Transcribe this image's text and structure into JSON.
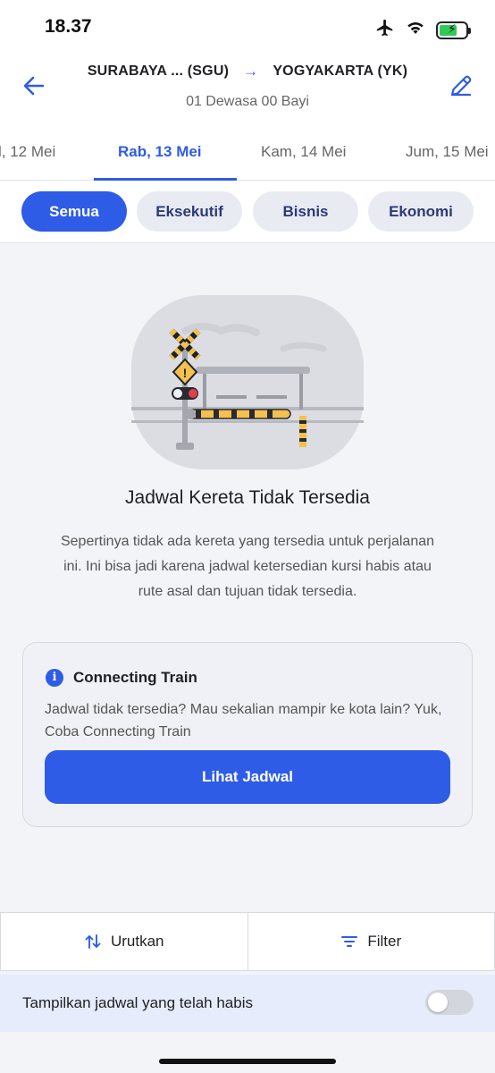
{
  "status_bar": {
    "time": "18.37",
    "icons": [
      "airplane-icon",
      "wifi-icon",
      "battery-charging-icon"
    ]
  },
  "header": {
    "origin": "SURABAYA ... (SGU)",
    "destination": "YOGYAKARTA (YK)",
    "passengers": "01 Dewasa 00 Bayi",
    "icons": [
      "back-arrow-icon",
      "route-arrow-icon",
      "edit-pencil-icon"
    ]
  },
  "date_tabs": [
    {
      "label": "l, 12 Mei",
      "active": false
    },
    {
      "label": "Rab, 13 Mei",
      "active": true
    },
    {
      "label": "Kam, 14 Mei",
      "active": false
    },
    {
      "label": "Jum, 15 Mei",
      "active": false
    }
  ],
  "class_filters": [
    {
      "label": "Semua",
      "active": true
    },
    {
      "label": "Eksekutif",
      "active": false
    },
    {
      "label": "Bisnis",
      "active": false
    },
    {
      "label": "Ekonomi",
      "active": false
    }
  ],
  "empty_state": {
    "illustration": "railway-crossing-illustration",
    "title": "Jadwal Kereta Tidak Tersedia",
    "description": "Sepertinya tidak ada kereta yang tersedia untuk perjalanan ini. Ini bisa jadi karena jadwal ketersedian kursi habis atau rute asal dan tujuan tidak tersedia."
  },
  "connecting_train": {
    "icon": "i",
    "title": "Connecting Train",
    "description": "Jadwal tidak tersedia? Mau sekalian mampir ke kota lain? Yuk, Coba Connecting Train",
    "button_label": "Lihat Jadwal"
  },
  "bottom_actions": {
    "sort_label": "Urutkan",
    "filter_label": "Filter"
  },
  "toggle": {
    "label": "Tampilkan jadwal yang telah habis",
    "on": false
  },
  "colors": {
    "primary": "#2e5ce6",
    "chip_bg": "#e9ebf3",
    "toggle_row_bg": "#e6ecfb"
  }
}
